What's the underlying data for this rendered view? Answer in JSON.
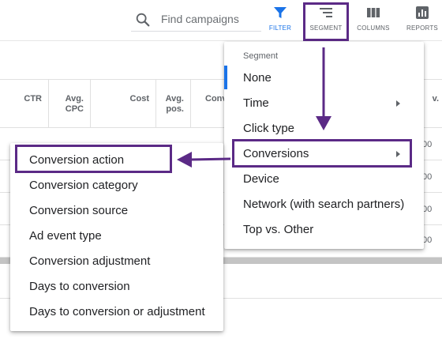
{
  "toolbar": {
    "search_placeholder": "Find campaigns",
    "filter_label": "FILTER",
    "segment_label": "SEGMENT",
    "columns_label": "COLUMNS",
    "reports_label": "REPORTS",
    "accent": "#1a73e8",
    "highlight_color": "#5b2a86"
  },
  "table": {
    "headers": [
      "CTR",
      "Avg. CPC",
      "Cost",
      "Avg. pos.",
      "Conv",
      "v."
    ],
    "right_values": [
      "00",
      "00",
      "00",
      "00"
    ]
  },
  "segment_menu": {
    "title": "Segment",
    "items": [
      {
        "label": "None",
        "has_submenu": false
      },
      {
        "label": "Time",
        "has_submenu": true
      },
      {
        "label": "Click type",
        "has_submenu": false
      },
      {
        "label": "Conversions",
        "has_submenu": true
      },
      {
        "label": "Device",
        "has_submenu": false
      },
      {
        "label": "Network (with search partners)",
        "has_submenu": false
      },
      {
        "label": "Top vs. Other",
        "has_submenu": false
      }
    ]
  },
  "conversions_submenu": {
    "items": [
      "Conversion action",
      "Conversion category",
      "Conversion source",
      "Ad event type",
      "Conversion adjustment",
      "Days to conversion",
      "Days to conversion or adjustment"
    ]
  }
}
